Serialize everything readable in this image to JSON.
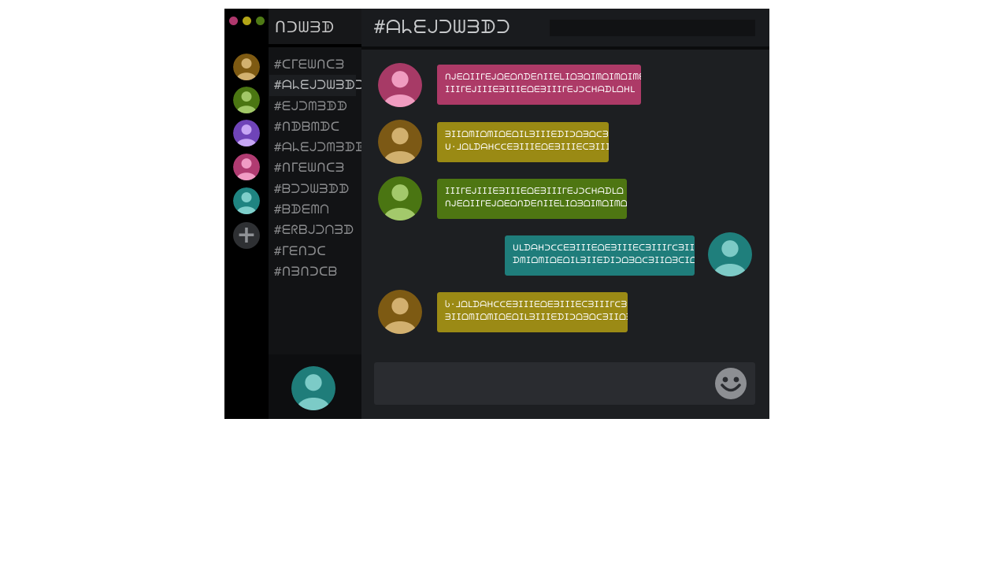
{
  "window_controls": [
    {
      "name": "close",
      "color": "#b0386d"
    },
    {
      "name": "minimize",
      "color": "#b3a517"
    },
    {
      "name": "maximize",
      "color": "#4f7a15"
    }
  ],
  "rail": {
    "servers": [
      {
        "name": "server-1",
        "bg": "#7e5a12",
        "fg": "#d2b16f"
      },
      {
        "name": "server-2",
        "bg": "#4b7612",
        "fg": "#a2c868"
      },
      {
        "name": "server-3",
        "bg": "#6f44b8",
        "fg": "#c7a6f4"
      },
      {
        "name": "server-4",
        "bg": "#b03b71",
        "fg": "#f09bc4"
      },
      {
        "name": "server-5",
        "bg": "#1f8481",
        "fg": "#7ecfcb"
      }
    ],
    "add_label": "+"
  },
  "sidebar": {
    "server_name": "ᑎᑐᗯᗱᗫ",
    "channels": [
      {
        "label": "#ᑕᒥᗴᗯᑎᑕᗱ",
        "active": false
      },
      {
        "label": "#ᗩᖺᗴᒍᑐᗯᗱᗫᑐ",
        "active": true
      },
      {
        "label": "#ᗴᒍᑐᗰᗱᗫᗫ",
        "active": false
      },
      {
        "label": "#ᑎᗫᗷᗰᗫᑕ",
        "active": false
      },
      {
        "label": "#ᗩᖺᗴᒍᑐᗰᗱᗫᗫ",
        "active": false
      },
      {
        "label": "#ᑎᒥᗴᗯᑎᑕᗱ",
        "active": false
      },
      {
        "label": "#ᗷᑐᑐᗯᗱᗫᗫ",
        "active": false
      },
      {
        "label": "#ᗷᗫᗴᗰᑎ",
        "active": false
      },
      {
        "label": "#ᗴᖇᗷᒍᑐᑎᗱᗫ",
        "active": false
      },
      {
        "label": "#ᒥᗴᑎᑐᑕ",
        "active": false
      },
      {
        "label": "#ᑎᗱᑎᑐᑕᗷ",
        "active": false
      }
    ],
    "current_user": {
      "bg": "#1f7d7a",
      "fg": "#7ccbc7"
    }
  },
  "header": {
    "channel_title": "#ᗩᖺᗴᒍᑐᗯᗱᗫᑐ",
    "search_placeholder": ""
  },
  "messages": [
    {
      "side": "left",
      "avatar": {
        "bg": "#a73a66",
        "fg": "#f09cc0"
      },
      "bubble_color": "#ad3a67",
      "lines": [
        "ᑎᒍᗴᗝIIᒥᗴᒍᗝᗴᗝᑎᗪᗴᑎIIᗴᒪIᗝᗱᗝIᗰᗝIᗰᗝIᗰᗴ",
        "IIIᒥᗴᒍIIIᗴᗱIIIᗴᗝᗴᗱIIIᒥᗴᒍᑐᑕᕼᗩᗪᒪᗝᕼᒪ"
      ]
    },
    {
      "side": "left",
      "avatar": {
        "bg": "#7c5915",
        "fg": "#d1b06e"
      },
      "bubble_color": "#9a8a14",
      "lines": [
        "ᗱIIᗝᗰIᗝᗰIᗝᗴᗝIᒪᗱIIIᗴᗪIᑐᗝᗱᗝᑕᗱI",
        "ᑌ·ᒧᗝᒪᗪᗩᕼᑕᑕᗴᗱIIIᗴᗝᗴᗱIIIᗴᑕᗱIII"
      ]
    },
    {
      "side": "left",
      "avatar": {
        "bg": "#4a7512",
        "fg": "#a3c96b"
      },
      "bubble_color": "#4e7612",
      "lines": [
        "IIIᒥᗴᒍIIIᗴᗱIIIᗴᗝᗴᗱIIIᒥᗴᒍᑐᑕᕼᗩᗪᒪᗝ",
        "ᑎᒍᗴᗝIIᒥᗴᒍᗝᗴᗝᑎᗪᗴᑎIIᗴᒪIᗝᗱᗝIᗰᗝIᗰᗝ"
      ]
    },
    {
      "side": "right",
      "avatar": {
        "bg": "#1f7f7c",
        "fg": "#7dcac6"
      },
      "bubble_color": "#1f7d7b",
      "lines": [
        "ᑌᒪᗪᗩᕼᑐᑕᑕᗴᗱIIIᗴᗝᗴᗱIIIᗴᑕᗱIIIᒥᑕᗱIII",
        "ᗪᗰIᗝᗰIᗝᗴᗝIᒪᗱIIᗴᗪIᑐᗝᗱᗝᑕᗱIIᗝᗱᑕIᗝ"
      ]
    },
    {
      "side": "left",
      "avatar": {
        "bg": "#7d5a13",
        "fg": "#d2b06f"
      },
      "bubble_color": "#9b8a15",
      "lines": [
        "Ⴑ·ᒧᗝᒪᗪᗩᕼᑕᑕᗴᗱIIIᗴᗝᗴᗱIIIᗴᑕᗱIIIᒥᑕᗱ",
        "ᗱIIᗝᗰIᗝᗰIᗝᗴᗝIᒪᗱIIIᗴᗪIᑐᗝᗱᗝᑕᗱIIᗝᗱᑕ"
      ]
    }
  ],
  "composer": {
    "placeholder": "",
    "emoji_icon": "smiley-icon"
  }
}
